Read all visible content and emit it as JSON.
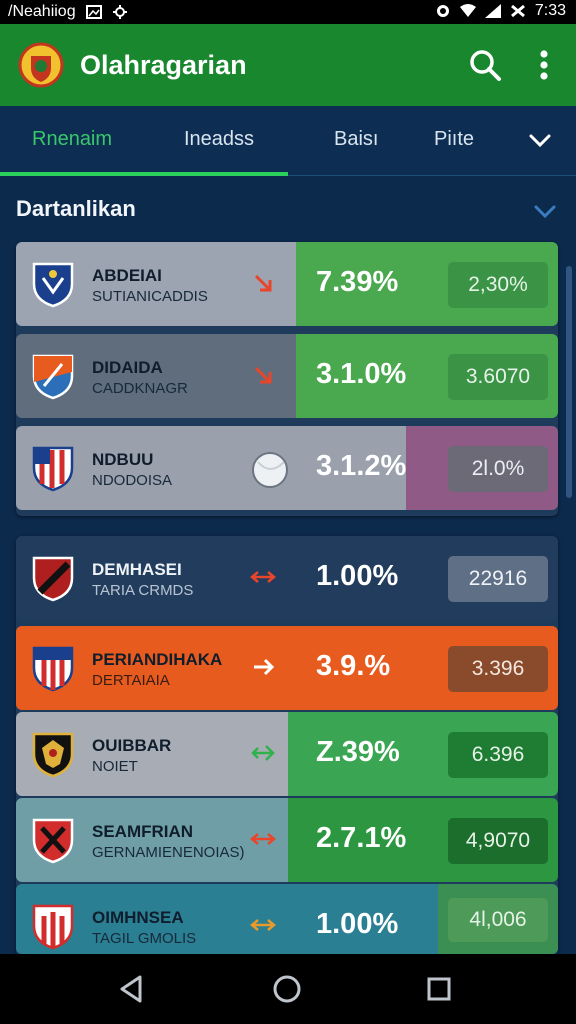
{
  "status_bar": {
    "app_label": "/Neahiiog",
    "time": "7:33",
    "icons": [
      "image-icon",
      "settings-icon",
      "alarm-icon",
      "wifi-icon",
      "signal-icon",
      "battery-icon"
    ]
  },
  "app_bar": {
    "title": "Olahragarian",
    "icons": [
      "logo-icon",
      "search-icon",
      "more-vert-icon"
    ]
  },
  "tabs": [
    {
      "label": "Rnenaim",
      "active": true
    },
    {
      "label": "Ineadss",
      "active": false
    },
    {
      "label": "Baisı",
      "active": false
    },
    {
      "label": "Piıte",
      "active": false
    }
  ],
  "section": {
    "title": "Dartanlikan"
  },
  "group1": [
    {
      "name": "ABDEIAI",
      "sub": "SUTIANICADDIS",
      "pct": "7.39%",
      "value": "2,30%",
      "trend": "down"
    },
    {
      "name": "DIDAIDA",
      "sub": "CADDKNAGR",
      "pct": "3.1.0%",
      "value": "3.6070",
      "trend": "down"
    },
    {
      "name": "NDBUU",
      "sub": "NDODOISA",
      "pct": "3.1.2%",
      "value": "2l.0%",
      "trend": "ball"
    }
  ],
  "group2": [
    {
      "name": "DEMHASEI",
      "sub": "TARIA CRMDS",
      "pct": "1.00%",
      "value": "22916",
      "trend": "flat"
    },
    {
      "name": "PERIANDIHAKA",
      "sub": "DERTAIAIA",
      "pct": "3.9.%",
      "value": "3.396",
      "trend": "right"
    },
    {
      "name": "OUIBBAR",
      "sub": "NOIET",
      "pct": "Z.39%",
      "value": "6.396",
      "trend": "up"
    },
    {
      "name": "SEAMFRIAN",
      "sub": "GERNAMIENENOIAS)",
      "pct": "2.7.1%",
      "value": "4,9070",
      "trend": "flat"
    },
    {
      "name": "OIMHNSEA",
      "sub": "TAGIL GMOLIS",
      "pct": "1.00%",
      "value": "4l,006",
      "trend": "flat"
    }
  ],
  "nav": {
    "icons": [
      "back-icon",
      "home-icon",
      "recents-icon"
    ]
  },
  "colors": {
    "app_bar": "#18872e",
    "background": "#0c2a4c",
    "tab_active": "#39c76a",
    "highlight_orange": "#e85b1e",
    "green_pane": "#4aa84e",
    "red_trend": "#e8452a"
  }
}
